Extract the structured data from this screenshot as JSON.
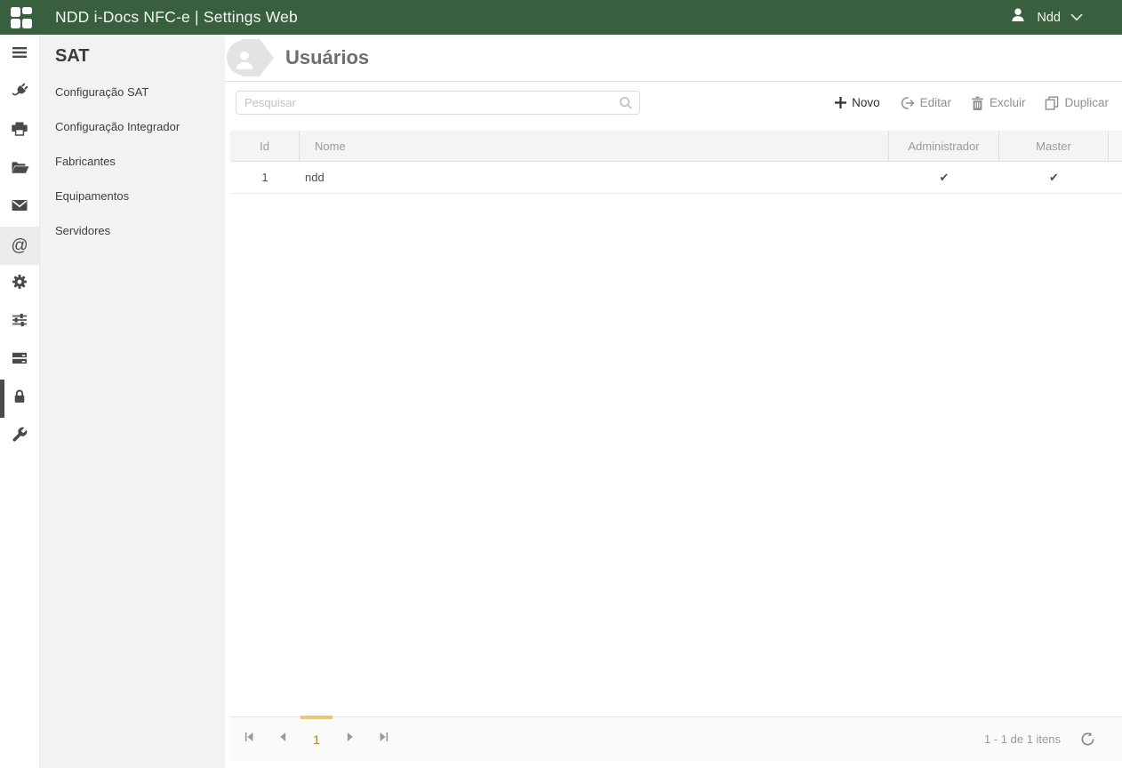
{
  "topbar": {
    "title": "NDD i-Docs NFC-e | Settings Web",
    "user_name": "Ndd"
  },
  "icon_rail": {
    "items": [
      {
        "icon": "menu"
      },
      {
        "icon": "plug"
      },
      {
        "icon": "printer"
      },
      {
        "icon": "folder-open"
      },
      {
        "icon": "mail"
      },
      {
        "icon": "at-sign",
        "highlighted": true,
        "glyph": "@"
      },
      {
        "icon": "gear"
      },
      {
        "icon": "sliders"
      },
      {
        "icon": "server"
      },
      {
        "icon": "lock",
        "active": true
      },
      {
        "icon": "wrench"
      }
    ]
  },
  "sidebar": {
    "heading": "SAT",
    "items": [
      {
        "label": "Configuração SAT"
      },
      {
        "label": "Configuração Integrador"
      },
      {
        "label": "Fabricantes"
      },
      {
        "label": "Equipamentos"
      },
      {
        "label": "Servidores"
      }
    ]
  },
  "page": {
    "title": "Usuários"
  },
  "toolbar": {
    "search_placeholder": "Pesquisar",
    "buttons": [
      {
        "label": "Novo",
        "icon": "plus",
        "enabled": true
      },
      {
        "label": "Editar",
        "icon": "edit-arrow",
        "enabled": false
      },
      {
        "label": "Excluir",
        "icon": "trash",
        "enabled": false
      },
      {
        "label": "Duplicar",
        "icon": "duplicate",
        "enabled": false
      }
    ]
  },
  "table": {
    "columns": [
      "Id",
      "Nome",
      "Administrador",
      "Master"
    ],
    "rows": [
      {
        "id": "1",
        "nome": "ndd",
        "administrador": "✔",
        "master": "✔"
      }
    ]
  },
  "pagination": {
    "current_page": "1",
    "status": "1 - 1 de 1 itens"
  },
  "colors": {
    "topbar_bg": "#3a5f3e",
    "selected_page_indicator": "#e4c87d",
    "selected_page_text": "#a97e2e"
  }
}
